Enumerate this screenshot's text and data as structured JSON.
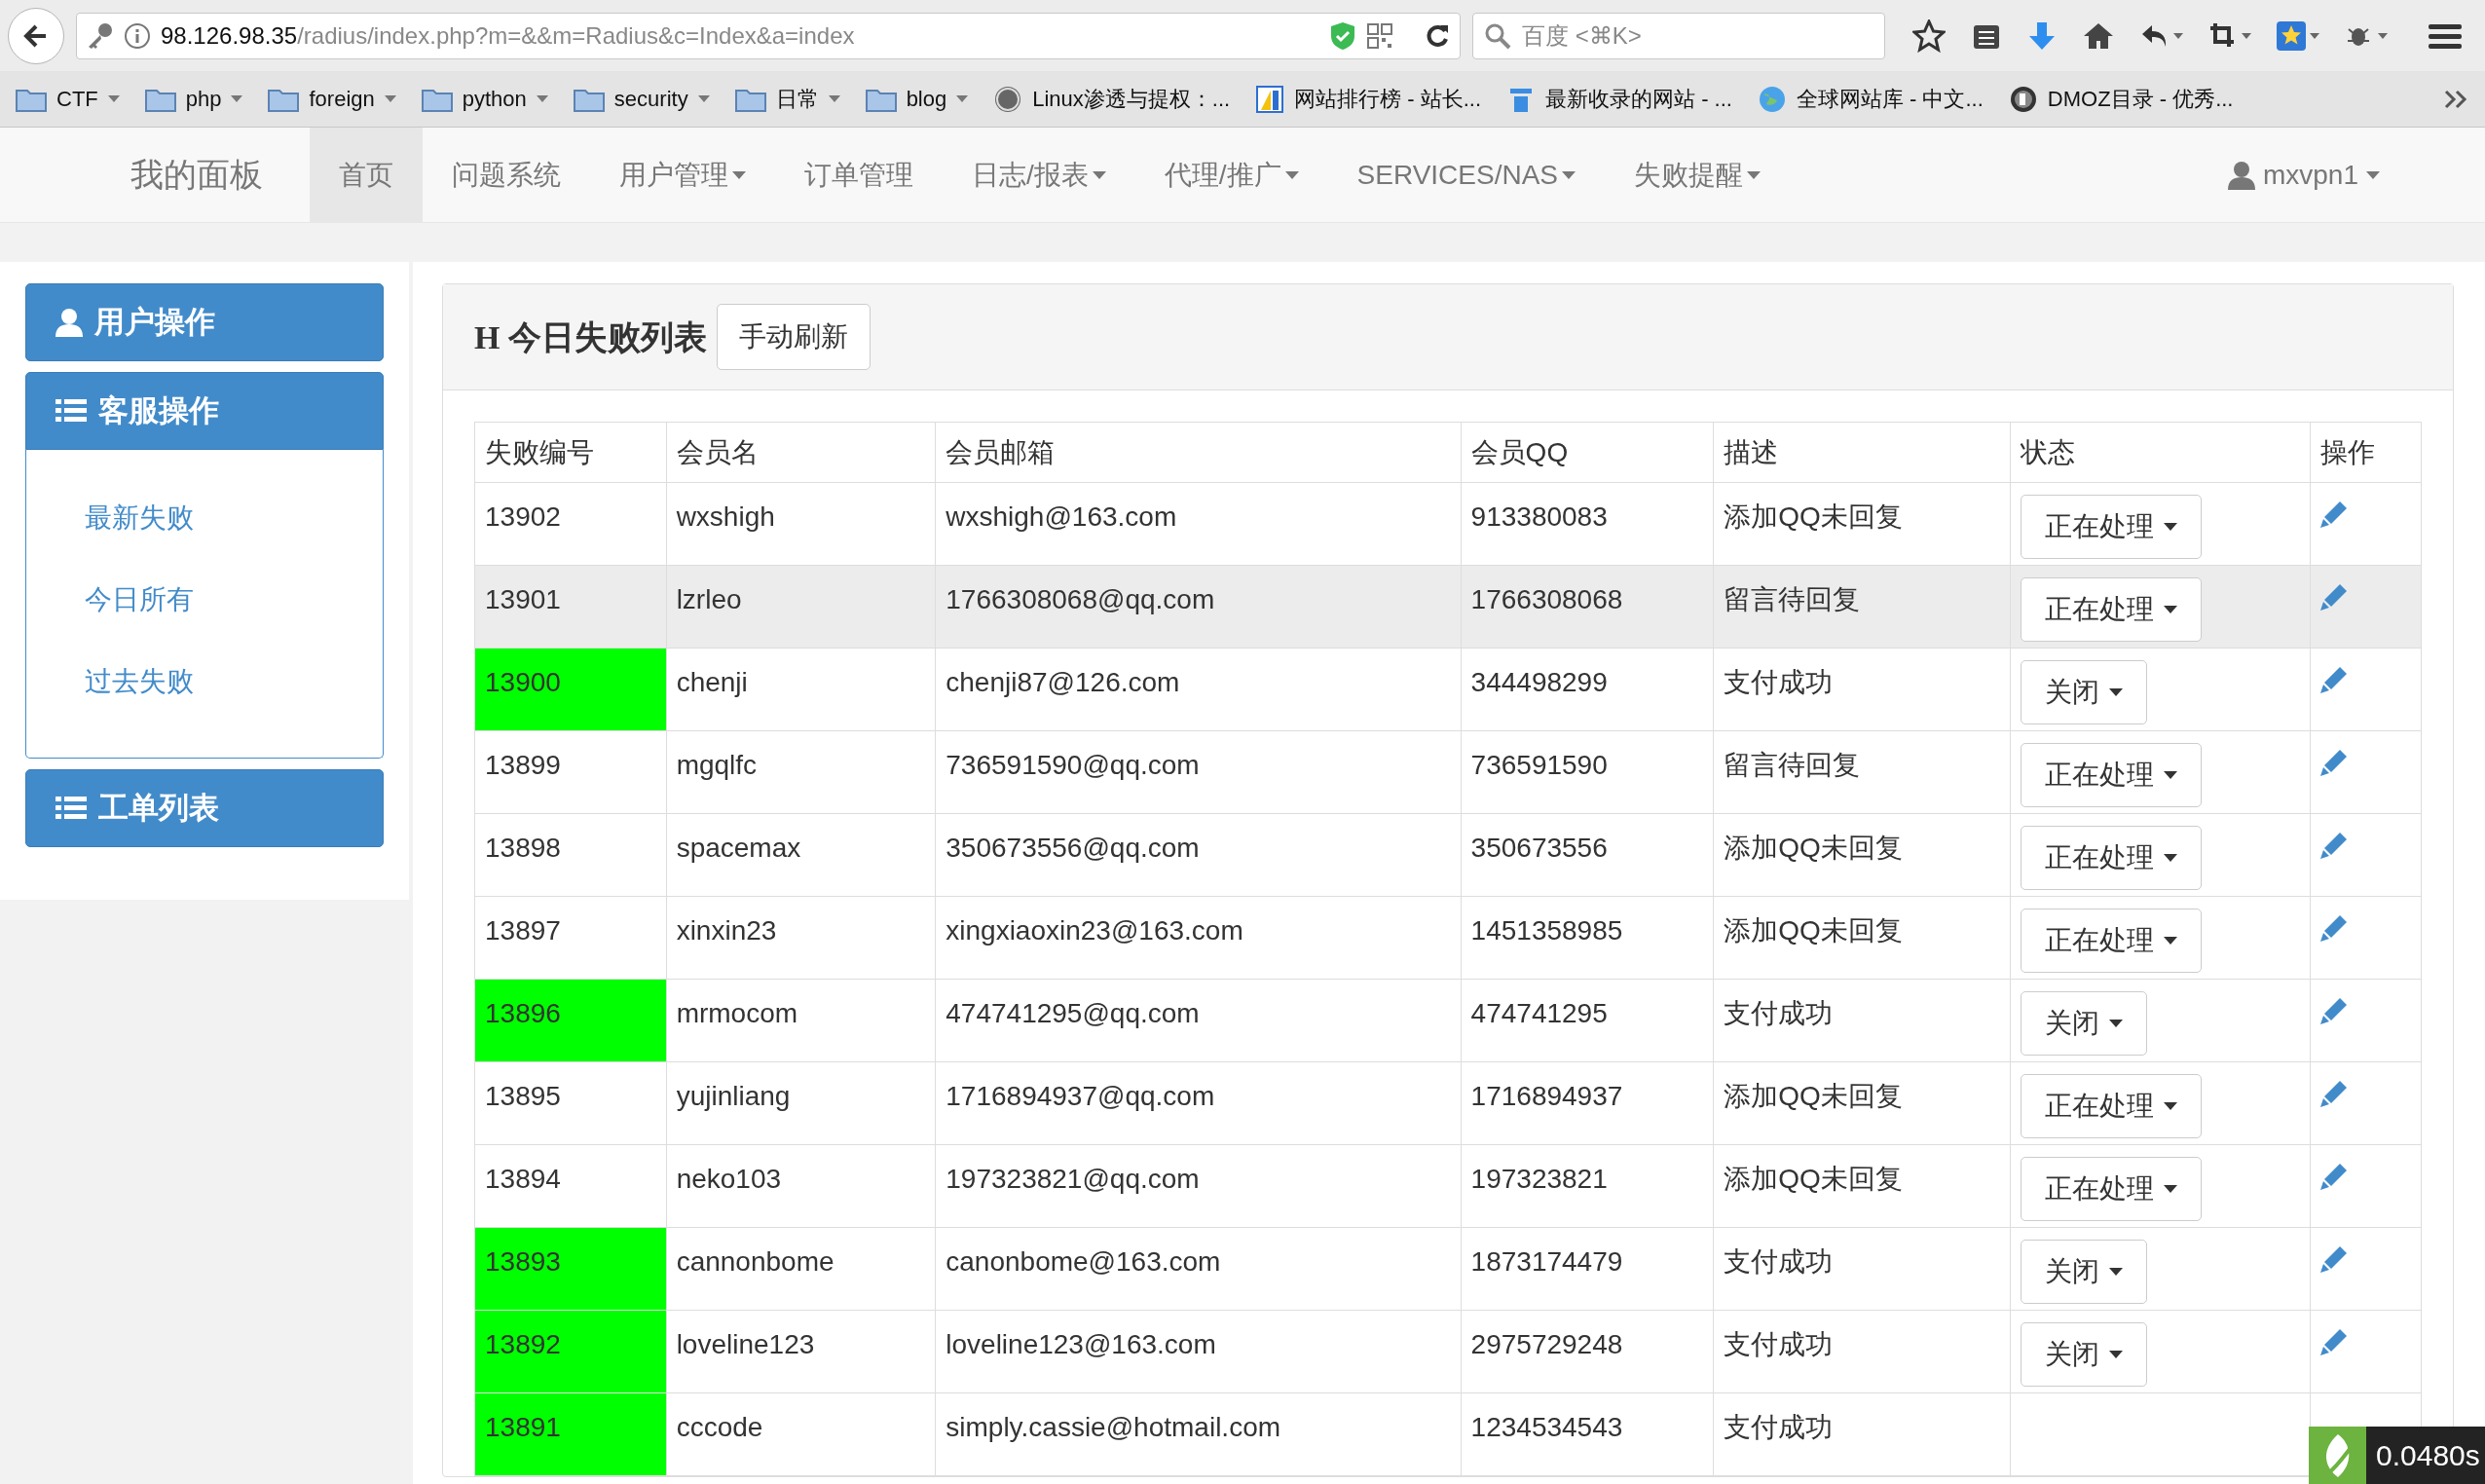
{
  "browser": {
    "url_host": "98.126.98.35",
    "url_path": "/radius/index.php?m=&&m=Radius&c=Index&a=index",
    "search_placeholder": "百度 <⌘K>"
  },
  "bookmarks": [
    {
      "kind": "folder",
      "label": "CTF"
    },
    {
      "kind": "folder",
      "label": "php"
    },
    {
      "kind": "folder",
      "label": "foreign"
    },
    {
      "kind": "folder",
      "label": "python"
    },
    {
      "kind": "folder",
      "label": "security"
    },
    {
      "kind": "folder",
      "label": "日常"
    },
    {
      "kind": "folder",
      "label": "blog"
    },
    {
      "kind": "site",
      "label": "Linux渗透与提权：..."
    },
    {
      "kind": "site",
      "label": "网站排行榜 - 站长..."
    },
    {
      "kind": "site",
      "label": "最新收录的网站 - ..."
    },
    {
      "kind": "site",
      "label": "全球网站库 - 中文..."
    },
    {
      "kind": "site",
      "label": "DMOZ目录 - 优秀..."
    }
  ],
  "navbar": {
    "brand": "我的面板",
    "items": [
      {
        "label": "首页",
        "dropdown": false,
        "selected": true
      },
      {
        "label": "问题系统",
        "dropdown": false,
        "selected": false
      },
      {
        "label": "用户管理",
        "dropdown": true,
        "selected": false
      },
      {
        "label": "订单管理",
        "dropdown": false,
        "selected": false
      },
      {
        "label": "日志/报表",
        "dropdown": true,
        "selected": false
      },
      {
        "label": "代理/推广",
        "dropdown": true,
        "selected": false
      },
      {
        "label": "SERVICES/NAS",
        "dropdown": true,
        "selected": false
      },
      {
        "label": "失败提醒",
        "dropdown": true,
        "selected": false
      }
    ],
    "user": "mxvpn1"
  },
  "sidebar": [
    {
      "label": "用户操作"
    },
    {
      "label": "客服操作",
      "links": [
        "最新失败",
        "今日所有",
        "过去失败"
      ]
    },
    {
      "label": "工单列表"
    }
  ],
  "panel": {
    "title": "H 今日失败列表",
    "refresh_button": "手动刷新"
  },
  "table": {
    "columns": [
      "失败编号",
      "会员名",
      "会员邮箱",
      "会员QQ",
      "描述",
      "状态",
      "操作"
    ],
    "rows": [
      {
        "id": "13902",
        "name": "wxshigh",
        "email": "wxshigh@163.com",
        "qq": "913380083",
        "desc": "添加QQ未回复",
        "status": "正在处理",
        "id_highlight": false,
        "hovered": false
      },
      {
        "id": "13901",
        "name": "lzrleo",
        "email": "1766308068@qq.com",
        "qq": "1766308068",
        "desc": "留言待回复",
        "status": "正在处理",
        "id_highlight": false,
        "hovered": true
      },
      {
        "id": "13900",
        "name": "chenji",
        "email": "chenji87@126.com",
        "qq": "344498299",
        "desc": "支付成功",
        "status": "关闭",
        "id_highlight": true,
        "hovered": false
      },
      {
        "id": "13899",
        "name": "mgqlfc",
        "email": "736591590@qq.com",
        "qq": "736591590",
        "desc": "留言待回复",
        "status": "正在处理",
        "id_highlight": false,
        "hovered": false
      },
      {
        "id": "13898",
        "name": "spacemax",
        "email": "350673556@qq.com",
        "qq": "350673556",
        "desc": "添加QQ未回复",
        "status": "正在处理",
        "id_highlight": false,
        "hovered": false
      },
      {
        "id": "13897",
        "name": "xinxin23",
        "email": "xingxiaoxin23@163.com",
        "qq": "1451358985",
        "desc": "添加QQ未回复",
        "status": "正在处理",
        "id_highlight": false,
        "hovered": false
      },
      {
        "id": "13896",
        "name": "mrmocom",
        "email": "474741295@qq.com",
        "qq": "474741295",
        "desc": "支付成功",
        "status": "关闭",
        "id_highlight": true,
        "hovered": false
      },
      {
        "id": "13895",
        "name": "yujinliang",
        "email": "1716894937@qq.com",
        "qq": "1716894937",
        "desc": "添加QQ未回复",
        "status": "正在处理",
        "id_highlight": false,
        "hovered": false
      },
      {
        "id": "13894",
        "name": "neko103",
        "email": "197323821@qq.com",
        "qq": "197323821",
        "desc": "添加QQ未回复",
        "status": "正在处理",
        "id_highlight": false,
        "hovered": false
      },
      {
        "id": "13893",
        "name": "cannonbome",
        "email": "canonbome@163.com",
        "qq": "1873174479",
        "desc": "支付成功",
        "status": "关闭",
        "id_highlight": true,
        "hovered": false
      },
      {
        "id": "13892",
        "name": "loveline123",
        "email": "loveline123@163.com",
        "qq": "2975729248",
        "desc": "支付成功",
        "status": "关闭",
        "id_highlight": true,
        "hovered": false
      },
      {
        "id": "13891",
        "name": "cccode",
        "email": "simply.cassie@hotmail.com",
        "qq": "1234534543",
        "desc": "支付成功",
        "id_highlight": true,
        "hovered": false
      }
    ]
  },
  "trace": {
    "time": "0.0480s"
  }
}
